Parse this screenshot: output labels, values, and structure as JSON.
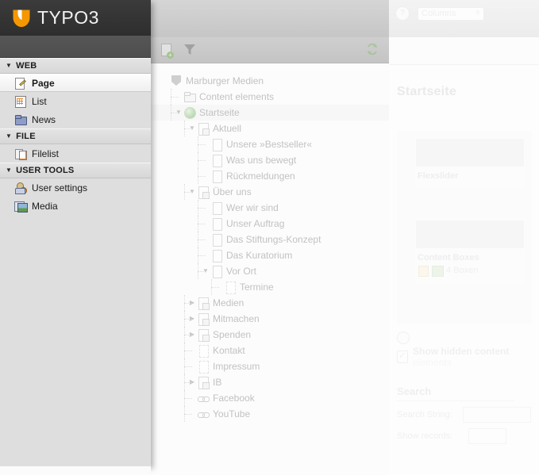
{
  "app": {
    "logo_text": "TYPO3",
    "logo_icon": "typo3-logo-icon"
  },
  "module_menu": {
    "sections": [
      {
        "label": "WEB",
        "caret": "▼",
        "items": [
          {
            "label": "Page",
            "icon": "page-edit-icon",
            "selected": true
          },
          {
            "label": "List",
            "icon": "list-icon",
            "selected": false
          },
          {
            "label": "News",
            "icon": "folder-icon",
            "selected": false
          }
        ]
      },
      {
        "label": "FILE",
        "caret": "▼",
        "items": [
          {
            "label": "Filelist",
            "icon": "filelist-icon",
            "selected": false
          }
        ]
      },
      {
        "label": "USER TOOLS",
        "caret": "▼",
        "items": [
          {
            "label": "User settings",
            "icon": "user-settings-icon",
            "selected": false
          },
          {
            "label": "Media",
            "icon": "media-icon",
            "selected": false
          }
        ]
      }
    ]
  },
  "tree_panel": {
    "toolbar": {
      "new_page_icon": "new-page-icon",
      "filter_icon": "filter-icon",
      "refresh_icon": "refresh-icon"
    },
    "nodes": [
      {
        "label": "Marburger Medien",
        "depth": 0,
        "icon": "typo3-root-icon",
        "toggle": "",
        "highlight": false
      },
      {
        "label": "Content elements",
        "depth": 1,
        "icon": "folder-icon",
        "toggle": "",
        "highlight": false
      },
      {
        "label": "Startseite",
        "depth": 1,
        "icon": "globe-icon",
        "toggle": "▼",
        "highlight": true
      },
      {
        "label": "Aktuell",
        "depth": 2,
        "icon": "shortcut-icon",
        "toggle": "▼",
        "highlight": false
      },
      {
        "label": "Unsere »Bestseller«",
        "depth": 3,
        "icon": "page-icon",
        "toggle": "",
        "highlight": false
      },
      {
        "label": "Was uns bewegt",
        "depth": 3,
        "icon": "page-icon",
        "toggle": "",
        "highlight": false
      },
      {
        "label": "Rückmeldungen",
        "depth": 3,
        "icon": "page-icon",
        "toggle": "",
        "highlight": false
      },
      {
        "label": "Über uns",
        "depth": 2,
        "icon": "shortcut-icon",
        "toggle": "▼",
        "highlight": false
      },
      {
        "label": "Wer wir sind",
        "depth": 3,
        "icon": "page-icon",
        "toggle": "",
        "highlight": false
      },
      {
        "label": "Unser Auftrag",
        "depth": 3,
        "icon": "page-icon",
        "toggle": "",
        "highlight": false
      },
      {
        "label": "Das Stiftungs-Konzept",
        "depth": 3,
        "icon": "page-icon",
        "toggle": "",
        "highlight": false
      },
      {
        "label": "Das Kuratorium",
        "depth": 3,
        "icon": "page-icon",
        "toggle": "",
        "highlight": false
      },
      {
        "label": "Vor Ort",
        "depth": 3,
        "icon": "page-icon",
        "toggle": "▼",
        "highlight": false
      },
      {
        "label": "Termine",
        "depth": 4,
        "icon": "page-hidden-icon",
        "toggle": "",
        "highlight": false
      },
      {
        "label": "Medien",
        "depth": 2,
        "icon": "shortcut-icon",
        "toggle": "▶",
        "highlight": false
      },
      {
        "label": "Mitmachen",
        "depth": 2,
        "icon": "shortcut-icon",
        "toggle": "▶",
        "highlight": false
      },
      {
        "label": "Spenden",
        "depth": 2,
        "icon": "shortcut-icon",
        "toggle": "▶",
        "highlight": false
      },
      {
        "label": "Kontakt",
        "depth": 2,
        "icon": "page-hidden-icon",
        "toggle": "",
        "highlight": false
      },
      {
        "label": "Impressum",
        "depth": 2,
        "icon": "page-hidden-icon",
        "toggle": "",
        "highlight": false
      },
      {
        "label": "IB",
        "depth": 2,
        "icon": "shortcut-icon",
        "toggle": "▶",
        "highlight": false
      },
      {
        "label": "Facebook",
        "depth": 2,
        "icon": "link-icon",
        "toggle": "",
        "highlight": false
      },
      {
        "label": "YouTube",
        "depth": 2,
        "icon": "link-icon",
        "toggle": "",
        "highlight": false
      }
    ]
  },
  "content_panel": {
    "help_icon": "help-icon",
    "view_mode": "Columns",
    "view_mode_chevron": "⇅",
    "view_icon": "view-page-icon",
    "edit_icon": "edit-page-icon",
    "page_title": "Startseite",
    "content_elements": [
      {
        "title": "Flexslider",
        "meta": "",
        "icons": []
      },
      {
        "title": "Content Boxes",
        "meta": "4 Boxen",
        "icons": [
          "clipboard-icon",
          "image-icon"
        ]
      }
    ],
    "hidden_toggle": {
      "label": "Show hidden content",
      "suffix": "elements",
      "checked": true,
      "checkbox_icon": "checkbox-checked-icon"
    },
    "search": {
      "title": "Search",
      "string_label": "Search String:",
      "string_value": "",
      "records_label": "Show records:",
      "records_value": ""
    }
  }
}
